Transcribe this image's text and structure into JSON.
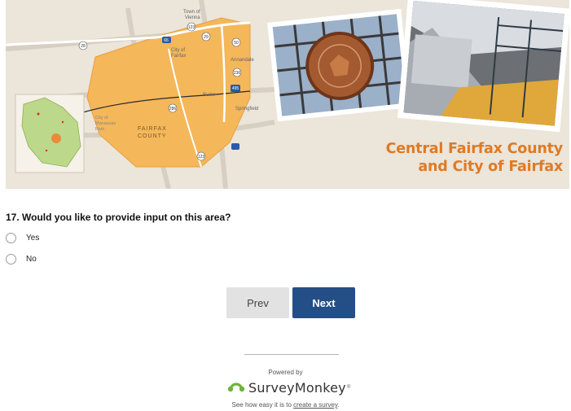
{
  "banner": {
    "title_line1": "Central Fairfax County",
    "title_line2": "and City of Fairfax",
    "map_labels": {
      "town_of_vienna": "Town of Vienna",
      "city_of_fairfax": "City of Fairfax",
      "annandale": "Annandale",
      "burke": "Burke",
      "springfield": "Springfield",
      "city_of_manassas_park": "City of Manassas Park",
      "fairfax_county": "FAIRFAX COUNTY"
    },
    "route_shields": [
      "123",
      "29",
      "50",
      "236",
      "495",
      "286",
      "66",
      "28",
      "123"
    ],
    "accent_color": "#e07a22"
  },
  "survey": {
    "question": "17. Would you like to provide input on this area?",
    "options": [
      "Yes",
      "No"
    ],
    "prev_label": "Prev",
    "next_label": "Next",
    "next_color": "#234f86"
  },
  "footer": {
    "powered_by": "Powered by",
    "brand": "SurveyMonkey",
    "tagline_prefix": "See how easy it is to",
    "link_text": "create a survey",
    "tagline_suffix": "."
  }
}
